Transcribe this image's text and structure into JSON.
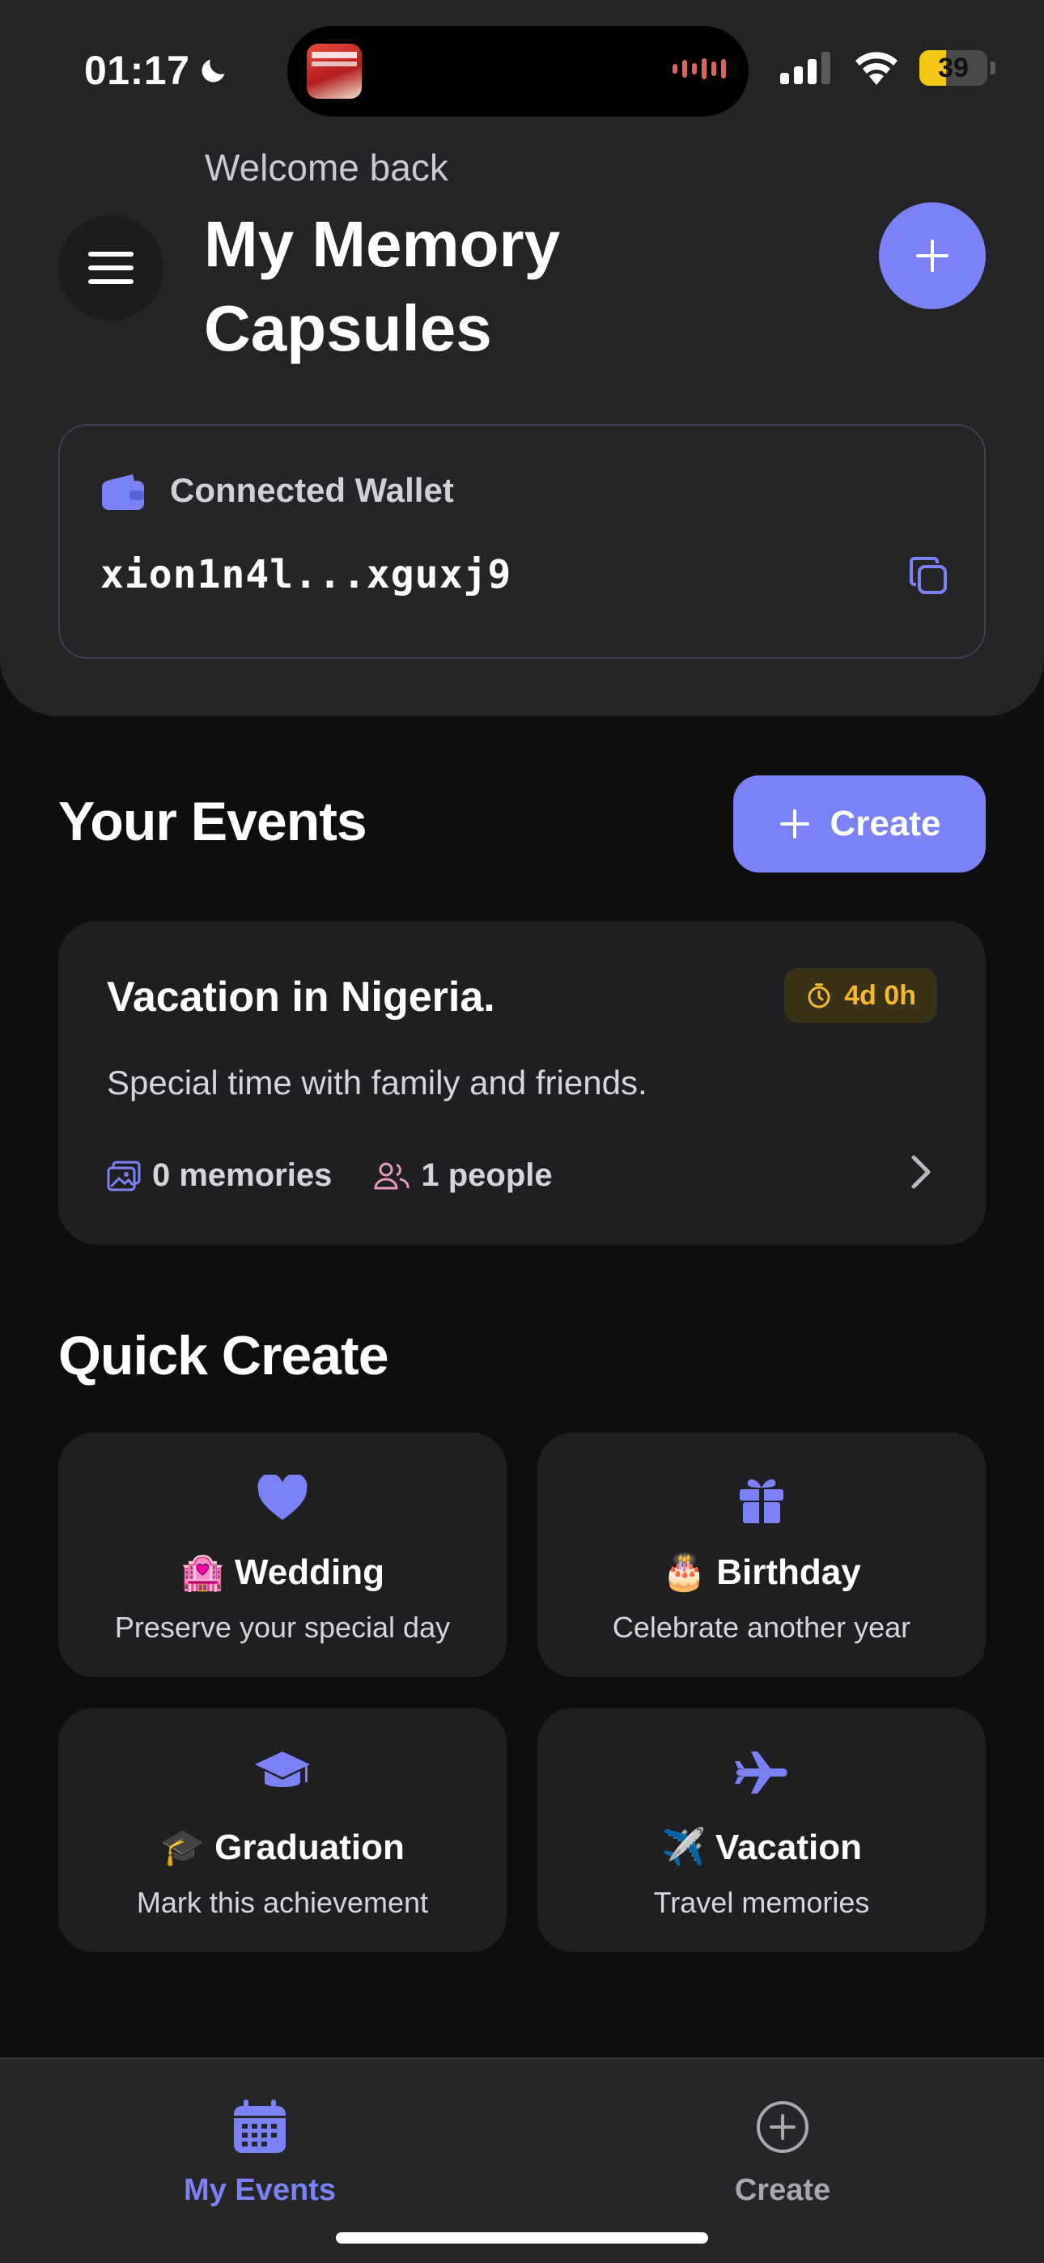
{
  "status_bar": {
    "time": "01:17",
    "battery": "39",
    "battery_level": 0.39
  },
  "header": {
    "welcome": "Welcome back",
    "title": "My Memory Capsules"
  },
  "wallet": {
    "label": "Connected Wallet",
    "address": "xion1n4l...xguxj9"
  },
  "events_section": {
    "title": "Your Events",
    "create_label": "Create"
  },
  "events": [
    {
      "title": "Vacation in Nigeria.",
      "countdown": "4d 0h",
      "description": "Special time with family and friends.",
      "memories": "0 memories",
      "people": "1 people"
    }
  ],
  "quick_create": {
    "title": "Quick Create",
    "items": [
      {
        "title": "🏩 Wedding",
        "subtitle": "Preserve your special day",
        "icon": "heart-icon"
      },
      {
        "title": "🎂 Birthday",
        "subtitle": "Celebrate another year",
        "icon": "gift-icon"
      },
      {
        "title": "🎓 Graduation",
        "subtitle": "Mark this achievement",
        "icon": "graduation-cap-icon"
      },
      {
        "title": "✈️ Vacation",
        "subtitle": "Travel memories",
        "icon": "airplane-icon"
      }
    ]
  },
  "tabbar": {
    "tabs": [
      {
        "label": "My Events",
        "icon": "calendar-icon",
        "active": true
      },
      {
        "label": "Create",
        "icon": "plus-circle-icon",
        "active": false
      }
    ]
  },
  "colors": {
    "accent": "#7b82f6",
    "background": "#0e0e0e",
    "header_bg": "#242426",
    "card_bg": "#1f1f21",
    "badge_text": "#f5b82e",
    "people_icon": "#e59ab8"
  }
}
